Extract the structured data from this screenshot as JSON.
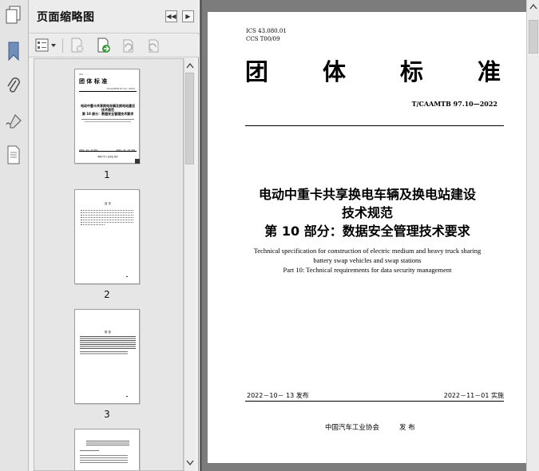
{
  "panel": {
    "title": "页面缩略图",
    "thumbnails": [
      {
        "page": "1"
      },
      {
        "page": "2"
      },
      {
        "page": "3"
      }
    ]
  },
  "thumb1": {
    "heading": "团 体 标 准",
    "code": "T/CAAMTB 97.10—2022",
    "title_line1": "电动中重卡共享换电车辆及换电站建设",
    "title_line2": "技术规范",
    "title_line3": "第 10 部分：数据安全管理技术要求",
    "pub_date": "2022－10－13 发布",
    "impl_date": "2022－11－01 实施",
    "publisher": "中国汽车工业协会  发布"
  },
  "thumb2": {
    "heading": "目 次"
  },
  "thumb3": {
    "heading": "前 言"
  },
  "document": {
    "ics": "ICS  43.080.01",
    "ccs": "CCS  T00/09",
    "heading_chars": [
      "团",
      "体",
      "标",
      "准"
    ],
    "standard_code": "T/CAAMTB 97.10—2022",
    "title_line1": "电动中重卡共享换电车辆及换电站建设",
    "title_line2": "技术规范",
    "title_line3": "第 10 部分：数据安全管理技术要求",
    "en_line1": "Technical specification for construction of electric medium and heavy truck sharing",
    "en_line2": "battery swap vehicles and swap stations",
    "en_line3": "Part 10: Technical requirements for data security management",
    "pub_date": "2022－10－ 13 发布",
    "impl_date": "2022－11－01 实施",
    "publisher": "中国汽车工业协会",
    "publisher_action": "发  布"
  }
}
